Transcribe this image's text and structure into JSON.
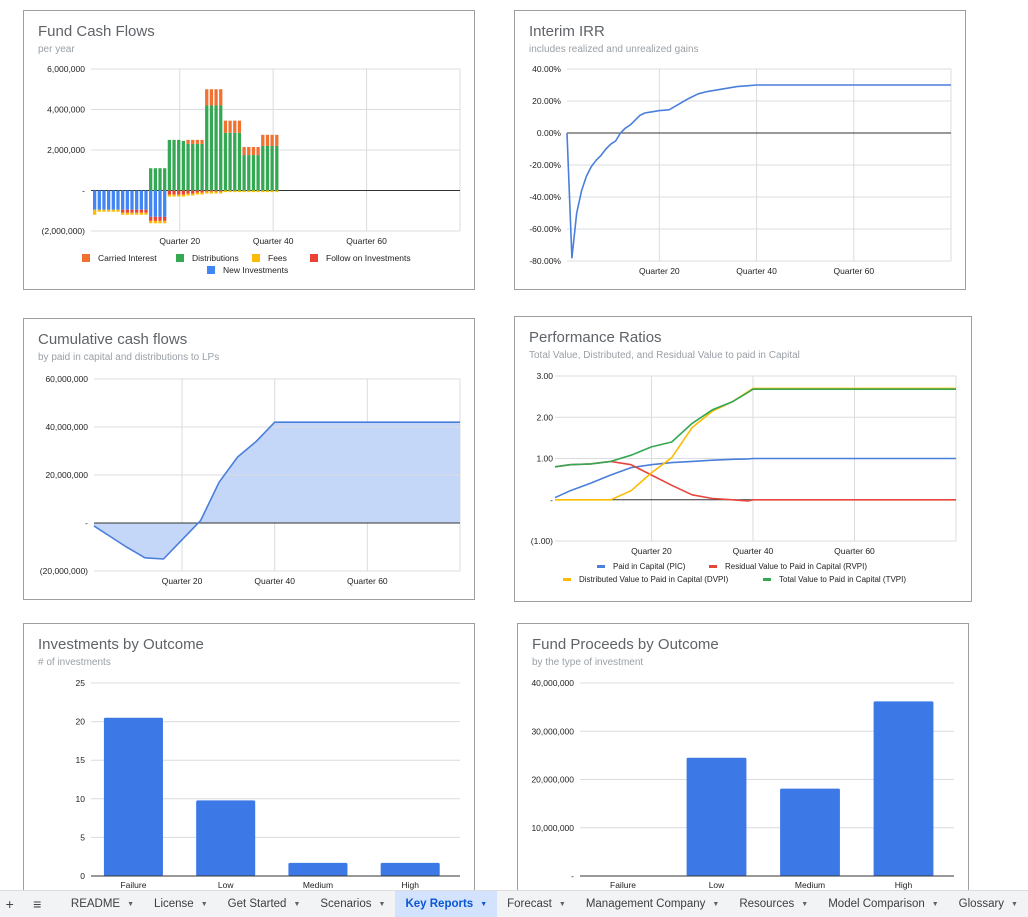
{
  "chart_data": [
    {
      "id": "fund-cash-flows",
      "type": "bar",
      "stacked": true,
      "title": "Fund Cash Flows",
      "subtitle": "per year",
      "xlabel": "",
      "ylabel": "",
      "ylim": [
        -2000000,
        6000000
      ],
      "yticks": [
        6000000,
        4000000,
        2000000,
        0,
        -2000000
      ],
      "ytick_labels": [
        "6,000,000",
        "4,000,000",
        "2,000,000",
        "-",
        "(2,000,000)"
      ],
      "x_range": [
        1,
        80
      ],
      "xticks": [
        20,
        40,
        60
      ],
      "xtick_labels": [
        "Quarter 20",
        "Quarter 40",
        "Quarter 60"
      ],
      "grid": true,
      "legend": "bottom",
      "colors": {
        "Carried Interest": "#f07130",
        "Distributions": "#34a853",
        "Fees": "#fbbc04",
        "Follow on Investments": "#ea4335",
        "New Investments": "#4285f4"
      },
      "quarters": 40,
      "series": [
        {
          "name": "Carried Interest",
          "values": [
            0,
            0,
            0,
            0,
            0,
            0,
            0,
            0,
            0,
            0,
            0,
            0,
            0,
            0,
            0,
            0,
            0,
            0,
            0,
            0,
            200000,
            200000,
            200000,
            200000,
            800000,
            800000,
            800000,
            800000,
            600000,
            600000,
            600000,
            600000,
            400000,
            400000,
            400000,
            400000,
            550000,
            550000,
            550000,
            550000
          ]
        },
        {
          "name": "Distributions",
          "values": [
            0,
            0,
            0,
            0,
            0,
            0,
            0,
            0,
            0,
            0,
            0,
            0,
            1100000,
            1100000,
            1100000,
            1100000,
            2500000,
            2500000,
            2500000,
            2450000,
            2300000,
            2300000,
            2300000,
            2300000,
            4200000,
            4200000,
            4200000,
            4200000,
            2850000,
            2850000,
            2850000,
            2850000,
            1750000,
            1750000,
            1750000,
            1750000,
            2200000,
            2200000,
            2200000,
            2200000
          ]
        },
        {
          "name": "Fees",
          "values": [
            -250000,
            -100000,
            -100000,
            -100000,
            -100000,
            -100000,
            -100000,
            -100000,
            -100000,
            -100000,
            -100000,
            -100000,
            -120000,
            -120000,
            -120000,
            -120000,
            -100000,
            -100000,
            -100000,
            -100000,
            -100000,
            -100000,
            -100000,
            -100000,
            -100000,
            -100000,
            -100000,
            -100000,
            -80000,
            -80000,
            -80000,
            -80000,
            -80000,
            -80000,
            -80000,
            -80000,
            -80000,
            -80000,
            -80000,
            -80000
          ]
        },
        {
          "name": "Follow on Investments",
          "values": [
            0,
            0,
            0,
            0,
            0,
            0,
            -150000,
            -150000,
            -150000,
            -150000,
            -150000,
            -150000,
            -200000,
            -200000,
            -200000,
            -200000,
            -200000,
            -200000,
            -200000,
            -200000,
            -150000,
            -150000,
            -100000,
            -100000,
            -50000,
            -50000,
            -50000,
            -50000,
            0,
            0,
            0,
            0,
            0,
            0,
            0,
            0,
            0,
            0,
            0,
            0
          ]
        },
        {
          "name": "New Investments",
          "values": [
            -950000,
            -950000,
            -950000,
            -950000,
            -950000,
            -950000,
            -950000,
            -950000,
            -950000,
            -950000,
            -950000,
            -950000,
            -1300000,
            -1300000,
            -1300000,
            -1300000,
            0,
            0,
            0,
            0,
            0,
            0,
            0,
            0,
            0,
            0,
            0,
            0,
            0,
            0,
            0,
            0,
            0,
            0,
            0,
            0,
            0,
            0,
            0,
            0
          ]
        }
      ]
    },
    {
      "id": "interim-irr",
      "type": "line",
      "title": "Interim IRR",
      "subtitle": "includes realized and unrealized gains",
      "ylim": [
        -0.8,
        0.4
      ],
      "yticks": [
        0.4,
        0.2,
        0,
        -0.2,
        -0.4,
        -0.6,
        -0.8
      ],
      "ytick_labels": [
        "40.00%",
        "20.00%",
        "0.00%",
        "-20.00%",
        "-40.00%",
        "-60.00%",
        "-80.00%"
      ],
      "x_range": [
        1,
        80
      ],
      "xticks": [
        20,
        40,
        60
      ],
      "xtick_labels": [
        "Quarter 20",
        "Quarter 40",
        "Quarter 60"
      ],
      "grid": true,
      "color": "#4a7fdc",
      "x": [
        1,
        2,
        3,
        4,
        5,
        6,
        7,
        8,
        9,
        10,
        11,
        12,
        13,
        14,
        15,
        16,
        17,
        18,
        19,
        20,
        22,
        24,
        26,
        28,
        30,
        32,
        34,
        36,
        38,
        40,
        80
      ],
      "values": [
        0,
        -0.78,
        -0.5,
        -0.36,
        -0.27,
        -0.21,
        -0.17,
        -0.14,
        -0.1,
        -0.07,
        -0.05,
        0,
        0.03,
        0.05,
        0.08,
        0.11,
        0.125,
        0.13,
        0.135,
        0.14,
        0.145,
        0.18,
        0.215,
        0.245,
        0.26,
        0.27,
        0.28,
        0.29,
        0.295,
        0.3,
        0.3
      ]
    },
    {
      "id": "cumulative-cash-flows",
      "type": "area",
      "title": "Cumulative cash flows",
      "subtitle": "by paid in capital and distributions to LPs",
      "ylim": [
        -20000000,
        60000000
      ],
      "yticks": [
        60000000,
        40000000,
        20000000,
        0,
        -20000000
      ],
      "ytick_labels": [
        "60,000,000",
        "40,000,000",
        "20,000,000",
        "-",
        "(20,000,000)"
      ],
      "x_range": [
        1,
        80
      ],
      "xticks": [
        20,
        40,
        60
      ],
      "xtick_labels": [
        "Quarter 20",
        "Quarter 40",
        "Quarter 60"
      ],
      "grid": true,
      "color": "#4a7fdc",
      "fill": "#c1d5f8",
      "x": [
        1,
        4,
        8,
        12,
        16,
        20,
        24,
        28,
        32,
        36,
        40,
        80
      ],
      "values": [
        -1200000,
        -5000000,
        -10000000,
        -14500000,
        -15000000,
        -7000000,
        1000000,
        17000000,
        27500000,
        34000000,
        42000000,
        42000000
      ]
    },
    {
      "id": "performance-ratios",
      "type": "line",
      "title": "Performance Ratios",
      "subtitle": "Total Value, Distributed, and Residual Value to paid in Capital",
      "ylim": [
        -1,
        3
      ],
      "yticks": [
        3,
        2,
        1,
        0,
        -1
      ],
      "ytick_labels": [
        "3.00",
        "2.00",
        "1.00",
        "-",
        "(1.00)"
      ],
      "x_range": [
        1,
        80
      ],
      "xticks": [
        20,
        40,
        60
      ],
      "xtick_labels": [
        "Quarter 20",
        "Quarter 40",
        "Quarter 60"
      ],
      "grid": true,
      "legend": "bottom",
      "x": [
        1,
        4,
        8,
        12,
        16,
        20,
        24,
        28,
        32,
        36,
        39,
        40,
        80
      ],
      "series": [
        {
          "name": "Paid in Capital (PIC)",
          "color": "#4a7fdc",
          "values": [
            0.05,
            0.22,
            0.4,
            0.6,
            0.78,
            0.85,
            0.9,
            0.93,
            0.96,
            0.98,
            0.99,
            1.0,
            1.0
          ]
        },
        {
          "name": "Residual Value to Paid in Capital (RVPI)",
          "color": "#e8453c",
          "values": [
            0.8,
            0.85,
            0.87,
            0.93,
            0.85,
            0.6,
            0.35,
            0.12,
            0.03,
            0.0,
            -0.03,
            0.0,
            0.0
          ]
        },
        {
          "name": "Distributed Value to Paid in Capital (DVPI)",
          "color": "#fbbc04",
          "values": [
            0,
            0,
            0,
            0,
            0.22,
            0.65,
            1.02,
            1.75,
            2.15,
            2.38,
            2.62,
            2.7,
            2.7
          ]
        },
        {
          "name": "Total Value to Paid in Capital (TVPI)",
          "color": "#34a853",
          "values": [
            0.8,
            0.85,
            0.87,
            0.93,
            1.08,
            1.28,
            1.4,
            1.85,
            2.18,
            2.38,
            2.6,
            2.68,
            2.68
          ]
        }
      ]
    },
    {
      "id": "investments-by-outcome",
      "type": "bar",
      "title": "Investments by Outcome",
      "subtitle": "# of investments",
      "ylim": [
        0,
        25
      ],
      "yticks": [
        25,
        20,
        15,
        10,
        5,
        0
      ],
      "ytick_labels": [
        "25",
        "20",
        "15",
        "10",
        "5",
        "0"
      ],
      "grid": true,
      "color": "#3d79e6",
      "categories": [
        "Failure",
        "Low",
        "Medium",
        "High"
      ],
      "values": [
        20.5,
        9.8,
        1.7,
        1.7
      ]
    },
    {
      "id": "fund-proceeds-by-outcome",
      "type": "bar",
      "title": "Fund Proceeds by Outcome",
      "subtitle": "by the type of investment",
      "ylim": [
        0,
        40000000
      ],
      "yticks": [
        40000000,
        30000000,
        20000000,
        10000000,
        0
      ],
      "ytick_labels": [
        "40,000,000",
        "30,000,000",
        "20,000,000",
        "10,000,000",
        "-"
      ],
      "grid": true,
      "color": "#3d79e6",
      "categories": [
        "Failure",
        "Low",
        "Medium",
        "High"
      ],
      "values": [
        0,
        24500000,
        18100000,
        36200000
      ]
    }
  ],
  "sheet_tabs": {
    "add_sheet_icon": "plus-icon",
    "all_sheets_icon": "menu-icon",
    "active": "Key Reports",
    "items": [
      {
        "label": "README"
      },
      {
        "label": "License"
      },
      {
        "label": "Get Started"
      },
      {
        "label": "Scenarios"
      },
      {
        "label": "Key Reports"
      },
      {
        "label": "Forecast"
      },
      {
        "label": "Management Company"
      },
      {
        "label": "Resources"
      },
      {
        "label": "Model Comparison"
      },
      {
        "label": "Glossary"
      }
    ]
  }
}
